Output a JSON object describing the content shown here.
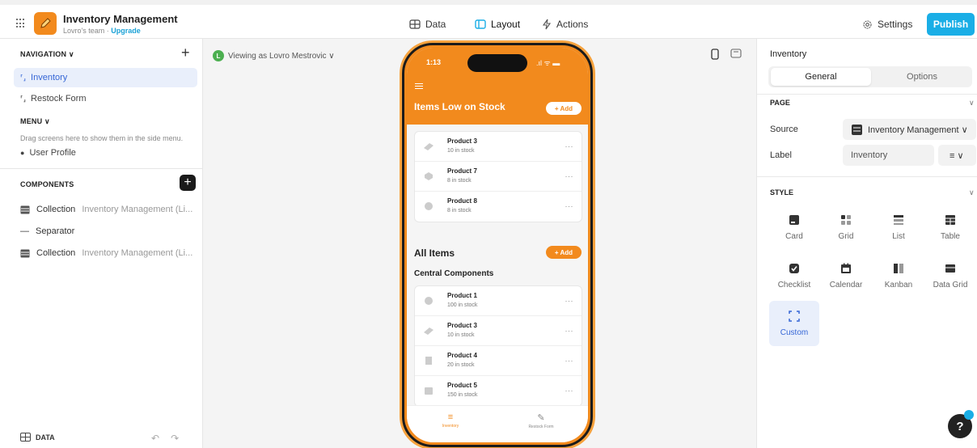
{
  "app": {
    "name": "Inventory Management",
    "team": "Lovro's team · ",
    "upgrade": "Upgrade"
  },
  "topnav": {
    "data": "Data",
    "layout": "Layout",
    "actions": "Actions",
    "settings": "Settings",
    "publish": "Publish"
  },
  "left": {
    "nav_head": "NAVIGATION ∨",
    "nav_items": [
      {
        "label": "Inventory"
      },
      {
        "label": "Restock Form"
      }
    ],
    "menu_head": "MENU ∨",
    "menu_hint": "Drag screens here to show them in the side menu.",
    "user_profile": "User Profile",
    "comp_head": "COMPONENTS",
    "components": [
      {
        "label": "Collection",
        "sub": "Inventory Management (Li..."
      },
      {
        "label": "Separator",
        "sub": ""
      },
      {
        "label": "Collection",
        "sub": "Inventory Management (Li..."
      }
    ],
    "bottom_data": "DATA"
  },
  "canvas": {
    "viewing": "Viewing as Lovro Mestrovic ∨",
    "avatar_letter": "L"
  },
  "phone": {
    "time": "1:13",
    "status": ".ıl ᯤ ▬",
    "low_title": "Items Low on Stock",
    "add_label": "+ Add",
    "low_items": [
      {
        "name": "Product 3",
        "stock": "10 in stock"
      },
      {
        "name": "Product 7",
        "stock": "8 in stock"
      },
      {
        "name": "Product 8",
        "stock": "8 in stock"
      }
    ],
    "all_title": "All Items",
    "group_title": "Central Components",
    "all_items": [
      {
        "name": "Product 1",
        "stock": "100 in stock"
      },
      {
        "name": "Product 3",
        "stock": "10 in stock"
      },
      {
        "name": "Product 4",
        "stock": "20 in stock"
      },
      {
        "name": "Product 5",
        "stock": "150 in stock"
      }
    ],
    "tab_inventory": "Inventory",
    "tab_restock": "Restock Form",
    "more": "···"
  },
  "right": {
    "title": "Inventory",
    "tab_general": "General",
    "tab_options": "Options",
    "page_head": "PAGE",
    "source_label": "Source",
    "source_value": "Inventory Management ∨",
    "label_label": "Label",
    "label_value": "Inventory",
    "style_head": "STYLE",
    "styles": [
      "Card",
      "Grid",
      "List",
      "Table",
      "Checklist",
      "Calendar",
      "Kanban",
      "Data Grid",
      "Custom"
    ]
  },
  "colors": {
    "brand_orange": "#f28a1d",
    "publish_blue": "#1aaee6",
    "select_blue": "#3566d6"
  }
}
